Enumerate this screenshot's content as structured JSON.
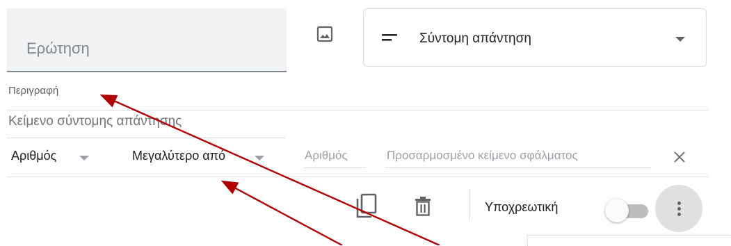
{
  "question": {
    "placeholder": "Ερώτηση"
  },
  "question_type": {
    "selected": "Σύντομη απάντηση"
  },
  "description": {
    "placeholder": "Περιγραφή"
  },
  "answer": {
    "placeholder": "Κείμενο σύντομης απάντησης"
  },
  "validation": {
    "type": "Αριθμός",
    "condition": "Μεγαλύτερο από",
    "number_placeholder": "Αριθμός",
    "error_placeholder": "Προσαρμοσμένο κείμενο σφάλματος"
  },
  "footer": {
    "required_label": "Υποχρεωτική",
    "required_on": false
  },
  "icons": {
    "image": "image-icon",
    "short_answer": "short-text-icon",
    "dropdown": "chevron-down-icon",
    "close": "close-icon",
    "copy": "content-copy-icon",
    "delete": "delete-icon",
    "more": "more-vert-icon"
  },
  "colors": {
    "annotation_arrow": "#b00000",
    "field_background": "#f1f3f4",
    "placeholder_text": "#80868b"
  }
}
